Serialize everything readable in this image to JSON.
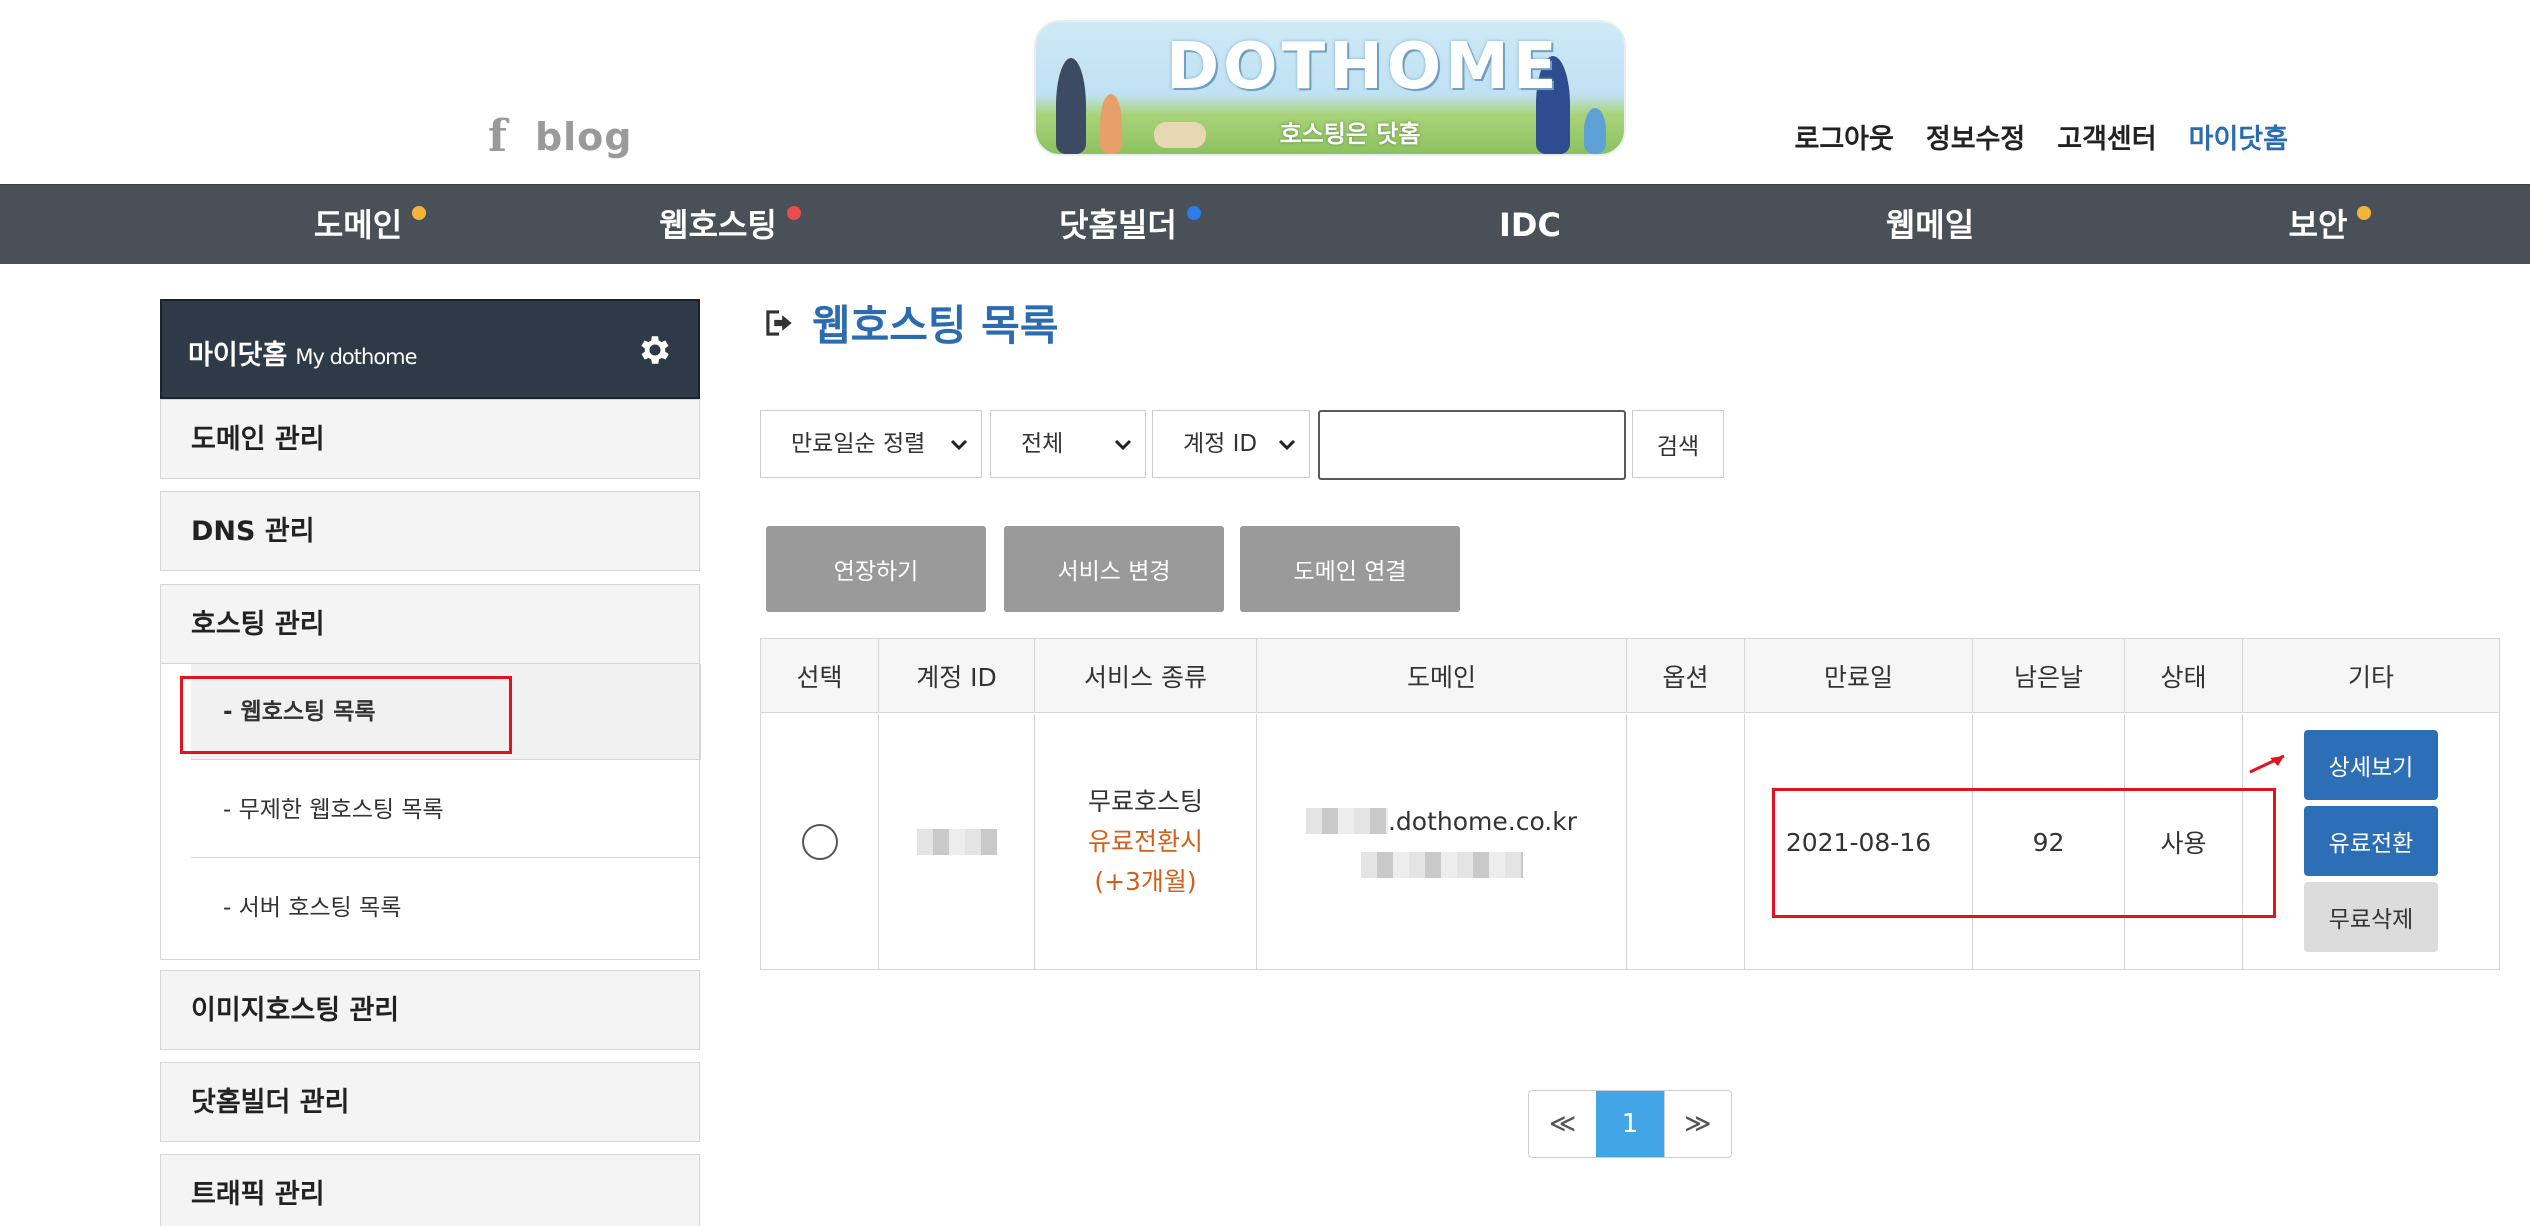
{
  "header": {
    "social": {
      "facebook": "f",
      "blog": "blog"
    },
    "banner": {
      "title": "DOTHOME",
      "subtitle": "호스팅은 닷홈"
    },
    "links": [
      "로그아웃",
      "정보수정",
      "고객센터",
      "마이닷홈"
    ]
  },
  "nav": {
    "items": [
      {
        "label": "도메인",
        "dot": "#f4b43c"
      },
      {
        "label": "웹호스팅",
        "dot": "#ea4d4d"
      },
      {
        "label": "닷홈빌더",
        "dot": "#2f7be8"
      },
      {
        "label": "IDC",
        "dot": ""
      },
      {
        "label": "웹메일",
        "dot": ""
      },
      {
        "label": "보안",
        "dot": "#f4b43c"
      }
    ]
  },
  "sidebar": {
    "title": "마이닷홈",
    "subtitle": "My dothome",
    "items": [
      "도메인 관리",
      "DNS 관리",
      "호스팅 관리",
      "이미지호스팅 관리",
      "닷홈빌더 관리",
      "트래픽 관리"
    ],
    "hosting_sub": [
      "- 웹호스팅 목록",
      "- 무제한 웹호스팅 목록",
      "- 서버 호스팅 목록"
    ]
  },
  "main": {
    "title": "웹호스팅 목록",
    "filters": {
      "sort": "만료일순 정렬",
      "scope": "전체",
      "field": "계정 ID",
      "query": "",
      "search_label": "검색"
    },
    "actions": [
      "연장하기",
      "서비스 변경",
      "도메인 연결"
    ],
    "table": {
      "headers": [
        "선택",
        "계정 ID",
        "서비스 종류",
        "도메인",
        "옵션",
        "만료일",
        "남은날",
        "상태",
        "기타"
      ],
      "row": {
        "service_type": "무료호스팅",
        "service_note_1": "유료전환시",
        "service_note_2": "(+3개월)",
        "domain_suffix": ".dothome.co.kr",
        "expiry": "2021-08-16",
        "days_left": "92",
        "status": "사용",
        "buttons": [
          "상세보기",
          "유료전환",
          "무료삭제"
        ]
      }
    },
    "pagination": {
      "prev": "≪",
      "current": "1",
      "next": "≫"
    }
  },
  "colors": {
    "accent": "#2b6cb0",
    "nav_bg": "#495057",
    "highlight": "#e0131f",
    "orange_text": "#d2601a",
    "pager_active": "#42a5e6"
  }
}
